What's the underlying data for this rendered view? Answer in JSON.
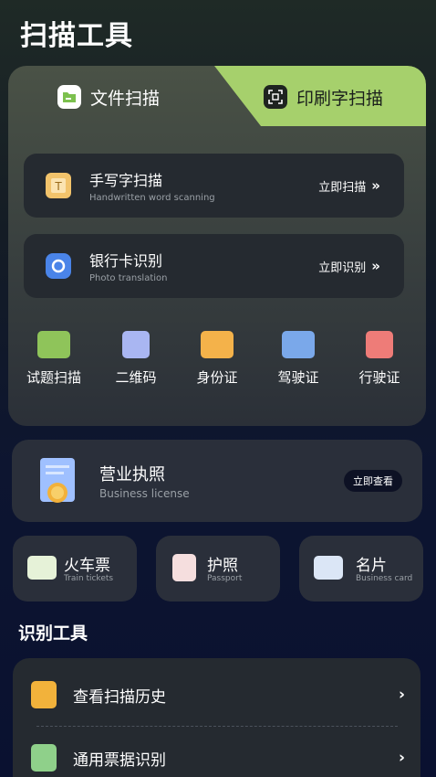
{
  "page": {
    "title": "扫描工具"
  },
  "tabs": [
    {
      "label": "文件扫描",
      "icon": "folder-icon",
      "active": false
    },
    {
      "label": "印刷字扫描",
      "icon": "scan-frame-icon",
      "active": true
    }
  ],
  "scan_rows": [
    {
      "title": "手写字扫描",
      "subtitle": "Handwritten word scanning",
      "action": "立即扫描",
      "icon": "handwriting-icon"
    },
    {
      "title": "银行卡识别",
      "subtitle": "Photo translation",
      "action": "立即识别",
      "icon": "bank-card-icon"
    }
  ],
  "shortcuts": [
    {
      "label": "试题扫描",
      "icon": "exam-scan-icon"
    },
    {
      "label": "二维码",
      "icon": "qrcode-icon"
    },
    {
      "label": "身份证",
      "icon": "id-card-icon"
    },
    {
      "label": "驾驶证",
      "icon": "driver-license-icon"
    },
    {
      "label": "行驶证",
      "icon": "vehicle-license-icon"
    }
  ],
  "license": {
    "title": "营业执照",
    "subtitle": "Business license",
    "button": "立即查看",
    "icon": "business-license-icon"
  },
  "small_cards": [
    {
      "title": "火车票",
      "subtitle": "Train tickets",
      "icon": "train-ticket-icon"
    },
    {
      "title": "护照",
      "subtitle": "Passport",
      "icon": "passport-icon"
    },
    {
      "title": "名片",
      "subtitle": "Business card",
      "icon": "business-card-icon"
    }
  ],
  "tools_section": {
    "title": "识别工具",
    "items": [
      {
        "label": "查看扫描历史",
        "icon": "history-icon"
      },
      {
        "label": "通用票据识别",
        "icon": "receipt-icon"
      }
    ]
  },
  "colors": {
    "accent": "#a6d06c",
    "card": "#2a2f3a",
    "background": "#0a1130"
  }
}
